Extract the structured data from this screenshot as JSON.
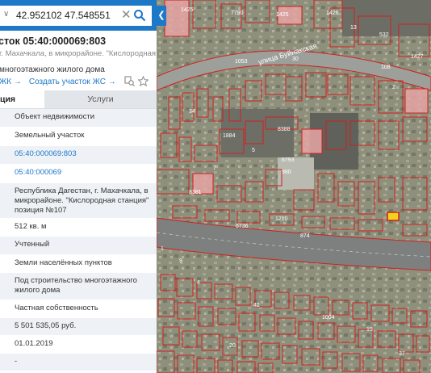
{
  "search": {
    "value": "42.952102 47.548551",
    "dropdown_glyph": "∨",
    "clear_glyph": "✕",
    "collapse_glyph": "❮"
  },
  "object": {
    "title": "сток 05:40:000069:803",
    "subtitle": "г. Махачкала, в микрорайоне. \"Кислородная станция\"",
    "kind": "многоэтажного жилого дома",
    "link_zk": "ЖК →",
    "link_create": "Создать участок ЖС →"
  },
  "tabs": {
    "info": "ция",
    "services": "Услуги"
  },
  "rows": [
    {
      "text": "Объект недвижимости",
      "style": "alt"
    },
    {
      "text": "Земельный участок",
      "style": ""
    },
    {
      "text": "05:40:000069:803",
      "style": "alt link"
    },
    {
      "text": "05:40:000069",
      "style": "link"
    },
    {
      "text": "Республика Дагестан, г. Махачкала, в микрорайоне. \"Кислородная станция\" позиция №107",
      "style": "alt"
    },
    {
      "text": "512 кв. м",
      "style": ""
    },
    {
      "text": "Учтенный",
      "style": "alt"
    },
    {
      "text": "Земли населённых пунктов",
      "style": ""
    },
    {
      "text": "Под строительство многоэтажного жилого дома",
      "style": "alt"
    },
    {
      "text": "Частная собственность",
      "style": ""
    },
    {
      "text": "5 501 535,05 руб.",
      "style": "alt",
      "key": "<:"
    },
    {
      "text": "01.01.2019",
      "style": ""
    },
    {
      "text": "-",
      "style": "alt"
    }
  ],
  "map": {
    "street_label": "улица Буйнакская",
    "colors": {
      "parcel": "#d11f1f",
      "highlight": "#f5d21a",
      "accent": "#1e78c8"
    },
    "numbers": [
      "1425",
      "7790",
      "1425",
      "1426",
      "13",
      "532",
      "1427",
      "108",
      "1053",
      "30",
      "2",
      "34",
      "1884",
      "8388",
      "6793",
      "7",
      "5",
      "980",
      "8381",
      "1210",
      "874",
      "6736",
      "1",
      "9",
      "4",
      "42",
      "1004",
      "15",
      "20",
      "37"
    ]
  }
}
